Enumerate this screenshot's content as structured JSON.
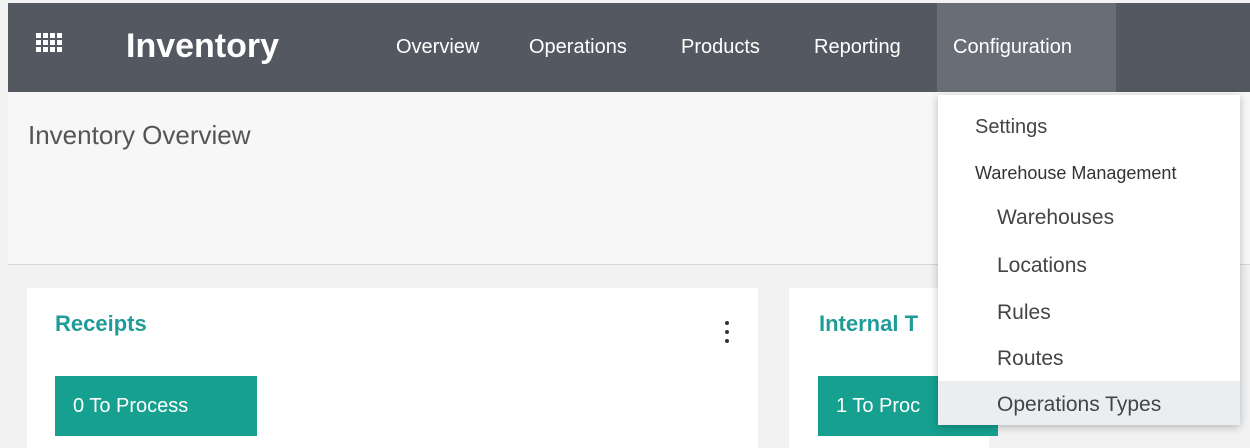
{
  "navbar": {
    "brand": "Inventory",
    "menu": [
      "Overview",
      "Operations",
      "Products",
      "Reporting",
      "Configuration"
    ]
  },
  "page": {
    "title": "Inventory Overview"
  },
  "cards": [
    {
      "title": "Receipts",
      "button": "0 To Process"
    },
    {
      "title": "Internal T",
      "button": "1 To Proc"
    }
  ],
  "dropdown": {
    "items": [
      {
        "label": "Settings"
      },
      {
        "label": "Warehouse Management"
      },
      {
        "label": "Warehouses"
      },
      {
        "label": "Locations"
      },
      {
        "label": "Rules"
      },
      {
        "label": "Routes"
      },
      {
        "label": "Operations Types"
      }
    ]
  },
  "colors": {
    "navbar": "#545860",
    "active_menu": "#686d76",
    "accent": "#1f9c97",
    "button": "#16a08f"
  }
}
